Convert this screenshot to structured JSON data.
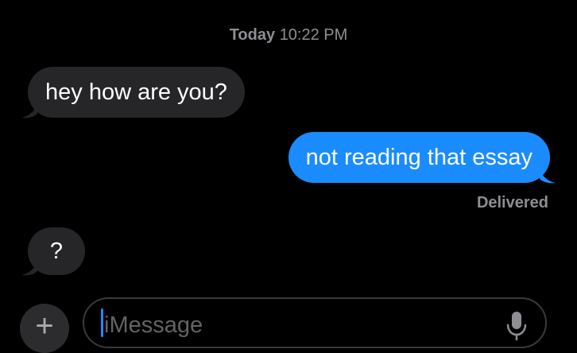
{
  "header": {
    "timestamp_day": "Today",
    "timestamp_time": "10:22 PM"
  },
  "messages": [
    {
      "direction": "incoming",
      "text": "hey how are you?"
    },
    {
      "direction": "outgoing",
      "text": "not reading that essay"
    },
    {
      "direction": "incoming",
      "text": "?"
    }
  ],
  "delivery_status": "Delivered",
  "composer": {
    "plus_label": "+",
    "placeholder": "iMessage",
    "mic_icon": "microphone-icon"
  },
  "colors": {
    "background": "#000000",
    "incoming_bubble": "#262629",
    "outgoing_bubble": "#1a8cff",
    "meta_text": "#8e8e93"
  }
}
